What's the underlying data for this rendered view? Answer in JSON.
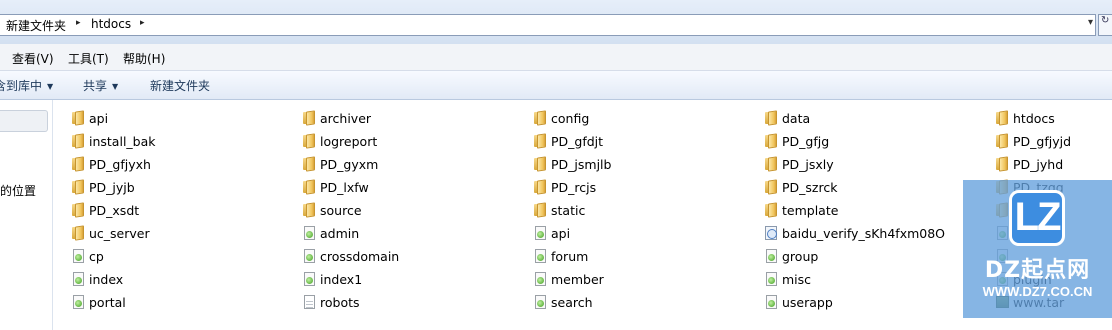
{
  "address": {
    "crumbs": [
      "新建文件夹",
      "htdocs"
    ],
    "separator": "▸",
    "dropdown": "▾",
    "refresh": "↻"
  },
  "menu": [
    "查看(V)",
    "工具(T)",
    "帮助(H)"
  ],
  "commands": [
    {
      "label": "含到库中",
      "has_arrow": true
    },
    {
      "label": "共享",
      "has_arrow": true
    },
    {
      "label": "新建文件夹",
      "has_arrow": false
    }
  ],
  "command_arrow": "▼",
  "nav": {
    "location_label": "的位置"
  },
  "files": [
    {
      "name": "api",
      "type": "folder",
      "icon": "folder-icon"
    },
    {
      "name": "install_bak",
      "type": "folder",
      "icon": "folder-icon"
    },
    {
      "name": "PD_gfjyxh",
      "type": "folder",
      "icon": "folder-icon"
    },
    {
      "name": "PD_jyjb",
      "type": "folder",
      "icon": "folder-icon"
    },
    {
      "name": "PD_xsdt",
      "type": "folder",
      "icon": "folder-icon"
    },
    {
      "name": "uc_server",
      "type": "folder",
      "icon": "folder-icon"
    },
    {
      "name": "cp",
      "type": "php",
      "icon": "php-file-icon"
    },
    {
      "name": "index",
      "type": "php",
      "icon": "php-file-icon"
    },
    {
      "name": "portal",
      "type": "php",
      "icon": "php-file-icon"
    },
    {
      "name": "archiver",
      "type": "folder",
      "icon": "folder-icon"
    },
    {
      "name": "logreport",
      "type": "folder",
      "icon": "folder-icon"
    },
    {
      "name": "PD_gyxm",
      "type": "folder",
      "icon": "folder-icon"
    },
    {
      "name": "PD_lxfw",
      "type": "folder",
      "icon": "folder-icon"
    },
    {
      "name": "source",
      "type": "folder",
      "icon": "folder-icon"
    },
    {
      "name": "admin",
      "type": "php",
      "icon": "php-file-icon"
    },
    {
      "name": "crossdomain",
      "type": "php",
      "icon": "php-file-icon"
    },
    {
      "name": "index1",
      "type": "php",
      "icon": "php-file-icon"
    },
    {
      "name": "robots",
      "type": "txt",
      "icon": "text-file-icon"
    },
    {
      "name": "config",
      "type": "folder",
      "icon": "folder-icon"
    },
    {
      "name": "PD_gfdjt",
      "type": "folder",
      "icon": "folder-icon"
    },
    {
      "name": "PD_jsmjlb",
      "type": "folder",
      "icon": "folder-icon"
    },
    {
      "name": "PD_rcjs",
      "type": "folder",
      "icon": "folder-icon"
    },
    {
      "name": "static",
      "type": "folder",
      "icon": "folder-icon"
    },
    {
      "name": "api",
      "type": "php",
      "icon": "php-file-icon"
    },
    {
      "name": "forum",
      "type": "php",
      "icon": "php-file-icon"
    },
    {
      "name": "member",
      "type": "php",
      "icon": "php-file-icon"
    },
    {
      "name": "search",
      "type": "php",
      "icon": "php-file-icon"
    },
    {
      "name": "data",
      "type": "folder",
      "icon": "folder-icon"
    },
    {
      "name": "PD_gfjg",
      "type": "folder",
      "icon": "folder-icon"
    },
    {
      "name": "PD_jsxly",
      "type": "folder",
      "icon": "folder-icon"
    },
    {
      "name": "PD_szrck",
      "type": "folder",
      "icon": "folder-icon"
    },
    {
      "name": "template",
      "type": "folder",
      "icon": "folder-icon"
    },
    {
      "name": "baidu_verify_sKh4fxm08O",
      "type": "html",
      "icon": "html-file-icon"
    },
    {
      "name": "group",
      "type": "php",
      "icon": "php-file-icon"
    },
    {
      "name": "misc",
      "type": "php",
      "icon": "php-file-icon"
    },
    {
      "name": "userapp",
      "type": "php",
      "icon": "php-file-icon"
    },
    {
      "name": "htdocs",
      "type": "folder",
      "icon": "folder-icon"
    },
    {
      "name": "PD_gfjyjd",
      "type": "folder",
      "icon": "folder-icon"
    },
    {
      "name": "PD_jyhd",
      "type": "folder",
      "icon": "folder-icon"
    },
    {
      "name": "PD_tzgg",
      "type": "folder",
      "icon": "folder-icon"
    },
    {
      "name": "",
      "type": "folder",
      "icon": "folder-icon"
    },
    {
      "name": "",
      "type": "php",
      "icon": "php-file-icon"
    },
    {
      "name": "",
      "type": "php",
      "icon": "php-file-icon"
    },
    {
      "name": "plugin",
      "type": "php",
      "icon": "php-file-icon"
    },
    {
      "name": "www.tar",
      "type": "tar",
      "icon": "archive-file-icon"
    }
  ],
  "watermark": {
    "logo_text": "LZ",
    "title": "DZ起点网",
    "url": "WWW.DZ7.CO.CN"
  }
}
